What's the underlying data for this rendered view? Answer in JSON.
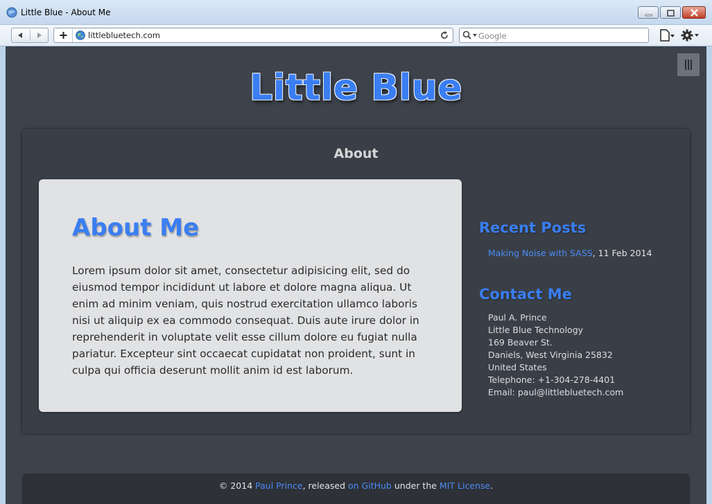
{
  "window": {
    "title": "Little Blue - About Me"
  },
  "toolbar": {
    "url": "littlebluetech.com",
    "search_placeholder": "Google"
  },
  "site": {
    "title": "Little Blue",
    "section": "About"
  },
  "main": {
    "heading": "About Me",
    "body": "Lorem ipsum dolor sit amet, consectetur adipisicing elit, sed do eiusmod tempor incididunt ut labore et dolore magna aliqua. Ut enim ad minim veniam, quis nostrud exercitation ullamco laboris nisi ut aliquip ex ea commodo consequat. Duis aute irure dolor in reprehenderit in voluptate velit esse cillum dolore eu fugiat nulla pariatur. Excepteur sint occaecat cupidatat non proident, sunt in culpa qui officia deserunt mollit anim id est laborum."
  },
  "sidebar": {
    "recent_heading": "Recent Posts",
    "posts": [
      {
        "title": "Making Noise with SASS",
        "date": ", 11 Feb 2014"
      }
    ],
    "contact_heading": "Contact Me",
    "contact": [
      "Paul A. Prince",
      "Little Blue Technology",
      "169 Beaver St.",
      "Daniels, West Virginia 25832",
      "United States",
      "Telephone: +1-304-278-4401",
      "Email: paul@littlebluetech.com"
    ]
  },
  "footer": {
    "prefix": "© 2014 ",
    "author": "Paul Prince",
    "mid1": ", released ",
    "github": "on GitHub",
    "mid2": " under the ",
    "license": "MIT License",
    "suffix": "."
  },
  "colors": {
    "accent": "#3a7ef2",
    "page_bg": "#3d424b",
    "card_bg": "#e1e2e4"
  },
  "icons": [
    "app-icon",
    "back-icon",
    "forward-icon",
    "add-tab-icon",
    "globe-icon",
    "reload-icon",
    "search-icon",
    "page-menu-icon",
    "gear-menu-icon",
    "hamburger-icon"
  ]
}
